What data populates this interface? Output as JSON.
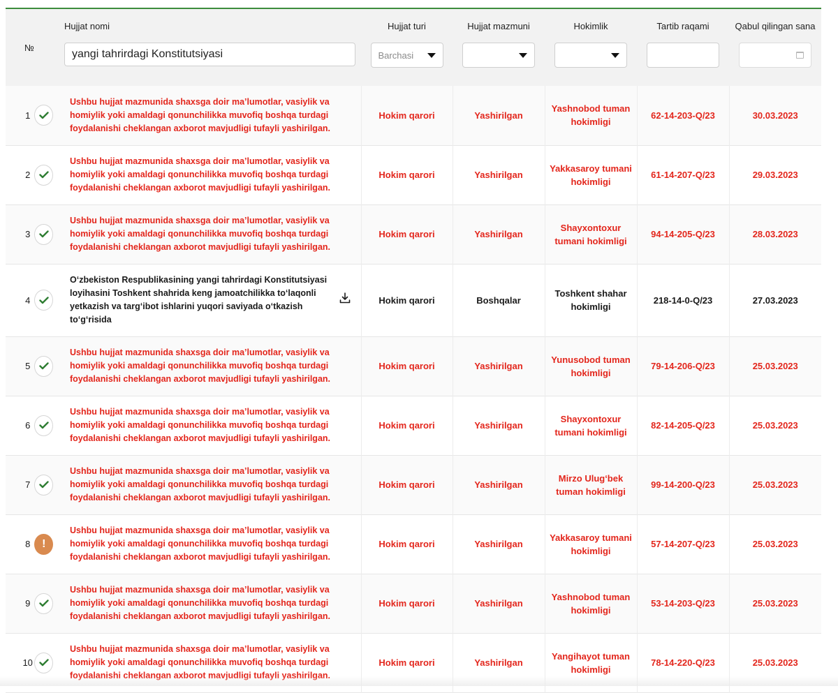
{
  "header": {
    "num": "№",
    "name": "Hujjat nomi",
    "type": "Hujjat turi",
    "content": "Hujjat mazmuni",
    "org": "Hokimlik",
    "reg": "Tartib raqami",
    "date": "Qabul qilingan sana"
  },
  "filters": {
    "search_value": "yangi tahrirdagi Konstitutsiyasi",
    "type_value": "Barchasi",
    "content_value": "",
    "org_value": "",
    "reg_value": "",
    "date_value": ""
  },
  "colors": {
    "accent": "#3c8c3c",
    "hidden_text": "#e3261c",
    "warning": "#d98a4f"
  },
  "rows": [
    {
      "num": "1",
      "status": "check-icon",
      "name": "Ushbu hujjat mazmunida shaxsga doir ma’lumotlar, vasiylik va homiylik yoki amaldagi qonunchilikka muvofiq boshqa turdagi foydalanishi cheklangan axborot mavjudligi tufayli yashirilgan.",
      "type": "Hokim qarori",
      "content": "Yashirilgan",
      "org": "Yashnobod tuman hokimligi",
      "reg": "62-14-203-Q/23",
      "date": "30.03.2023",
      "hidden": true
    },
    {
      "num": "2",
      "status": "check-icon",
      "name": "Ushbu hujjat mazmunida shaxsga doir ma’lumotlar, vasiylik va homiylik yoki amaldagi qonunchilikka muvofiq boshqa turdagi foydalanishi cheklangan axborot mavjudligi tufayli yashirilgan.",
      "type": "Hokim qarori",
      "content": "Yashirilgan",
      "org": "Yakkasaroy tumani hokimligi",
      "reg": "61-14-207-Q/23",
      "date": "29.03.2023",
      "hidden": true
    },
    {
      "num": "3",
      "status": "check-icon",
      "name": "Ushbu hujjat mazmunida shaxsga doir ma’lumotlar, vasiylik va homiylik yoki amaldagi qonunchilikka muvofiq boshqa turdagi foydalanishi cheklangan axborot mavjudligi tufayli yashirilgan.",
      "type": "Hokim qarori",
      "content": "Yashirilgan",
      "org": "Shayxontoxur tumani hokimligi",
      "reg": "94-14-205-Q/23",
      "date": "28.03.2023",
      "hidden": true
    },
    {
      "num": "4",
      "status": "check-icon",
      "name": "O‘zbekiston Respublikasining yangi tahrirdagi Konstitutsiyasi loyihasini Toshkent shahrida keng jamoatchilikka to‘laqonli yetkazish va targ‘ibot ishlarini yuqori saviyada o‘tkazish to‘g‘risida",
      "type": "Hokim qarori",
      "content": "Boshqalar",
      "org": "Toshkent shahar hokimligi",
      "reg": "218-14-0-Q/23",
      "date": "27.03.2023",
      "hidden": false
    },
    {
      "num": "5",
      "status": "check-icon",
      "name": "Ushbu hujjat mazmunida shaxsga doir ma’lumotlar, vasiylik va homiylik yoki amaldagi qonunchilikka muvofiq boshqa turdagi foydalanishi cheklangan axborot mavjudligi tufayli yashirilgan.",
      "type": "Hokim qarori",
      "content": "Yashirilgan",
      "org": "Yunusobod tuman hokimligi",
      "reg": "79-14-206-Q/23",
      "date": "25.03.2023",
      "hidden": true
    },
    {
      "num": "6",
      "status": "check-icon",
      "name": "Ushbu hujjat mazmunida shaxsga doir ma’lumotlar, vasiylik va homiylik yoki amaldagi qonunchilikka muvofiq boshqa turdagi foydalanishi cheklangan axborot mavjudligi tufayli yashirilgan.",
      "type": "Hokim qarori",
      "content": "Yashirilgan",
      "org": "Shayxontoxur tumani hokimligi",
      "reg": "82-14-205-Q/23",
      "date": "25.03.2023",
      "hidden": true
    },
    {
      "num": "7",
      "status": "check-icon",
      "name": "Ushbu hujjat mazmunida shaxsga doir ma’lumotlar, vasiylik va homiylik yoki amaldagi qonunchilikka muvofiq boshqa turdagi foydalanishi cheklangan axborot mavjudligi tufayli yashirilgan.",
      "type": "Hokim qarori",
      "content": "Yashirilgan",
      "org": "Mirzo Ulug‘bek tuman hokimligi",
      "reg": "99-14-200-Q/23",
      "date": "25.03.2023",
      "hidden": true
    },
    {
      "num": "8",
      "status": "warning-icon",
      "name": "Ushbu hujjat mazmunida shaxsga doir ma’lumotlar, vasiylik va homiylik yoki amaldagi qonunchilikka muvofiq boshqa turdagi foydalanishi cheklangan axborot mavjudligi tufayli yashirilgan.",
      "type": "Hokim qarori",
      "content": "Yashirilgan",
      "org": "Yakkasaroy tumani hokimligi",
      "reg": "57-14-207-Q/23",
      "date": "25.03.2023",
      "hidden": true
    },
    {
      "num": "9",
      "status": "check-icon",
      "name": "Ushbu hujjat mazmunida shaxsga doir ma’lumotlar, vasiylik va homiylik yoki amaldagi qonunchilikka muvofiq boshqa turdagi foydalanishi cheklangan axborot mavjudligi tufayli yashirilgan.",
      "type": "Hokim qarori",
      "content": "Yashirilgan",
      "org": "Yashnobod tuman hokimligi",
      "reg": "53-14-203-Q/23",
      "date": "25.03.2023",
      "hidden": true
    },
    {
      "num": "10",
      "status": "check-icon",
      "name": "Ushbu hujjat mazmunida shaxsga doir ma’lumotlar, vasiylik va homiylik yoki amaldagi qonunchilikka muvofiq boshqa turdagi foydalanishi cheklangan axborot mavjudligi tufayli yashirilgan.",
      "type": "Hokim qarori",
      "content": "Yashirilgan",
      "org": "Yangihayot tuman hokimligi",
      "reg": "78-14-220-Q/23",
      "date": "25.03.2023",
      "hidden": true
    }
  ]
}
